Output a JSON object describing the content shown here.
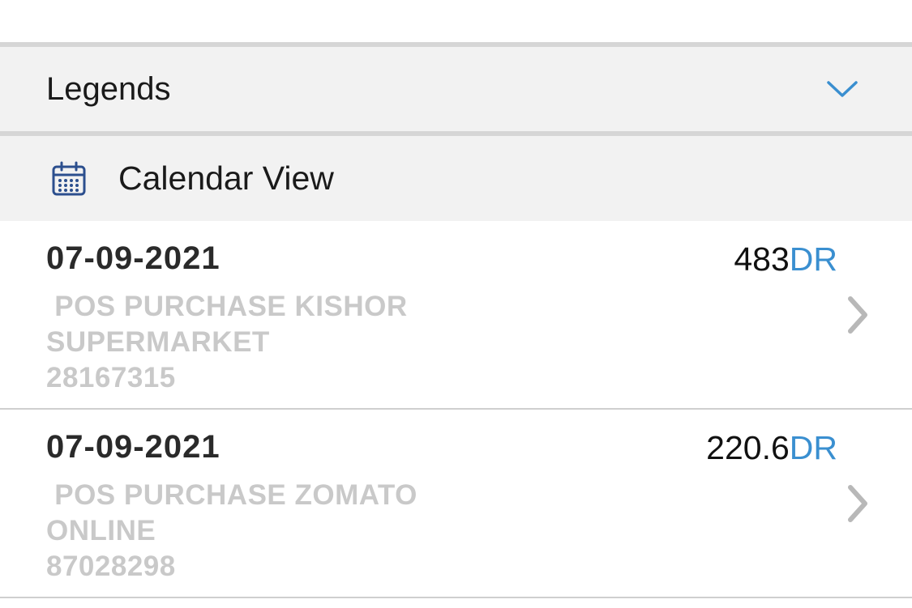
{
  "legends": {
    "title": "Legends",
    "toggle_icon": "chevron-down-icon",
    "accent_color": "#3a8fd0"
  },
  "calendar": {
    "title": "Calendar View",
    "icon": "calendar-icon"
  },
  "transactions": [
    {
      "date": "07-09-2021",
      "amount": "483",
      "type": "DR",
      "description_lines": [
        " POS PURCHASE KISHOR",
        "SUPERMARKET",
        "28167315"
      ],
      "icon": "chevron-right-icon"
    },
    {
      "date": "07-09-2021",
      "amount": "220.6",
      "type": "DR",
      "description_lines": [
        " POS PURCHASE ZOMATO",
        "ONLINE",
        "87028298"
      ],
      "icon": "chevron-right-icon"
    }
  ]
}
